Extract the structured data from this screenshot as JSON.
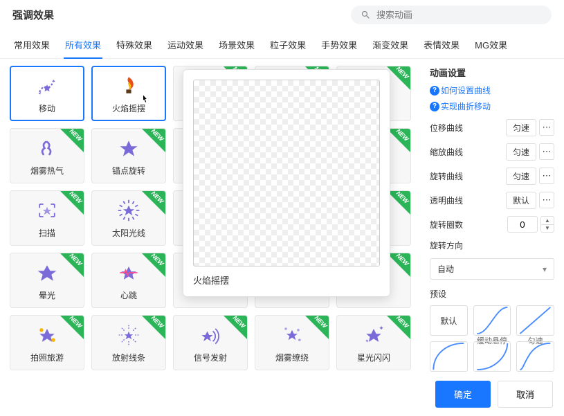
{
  "title": "强调效果",
  "search_placeholder": "搜索动画",
  "tabs": [
    "常用效果",
    "所有效果",
    "特殊效果",
    "运动效果",
    "场景效果",
    "粒子效果",
    "手势效果",
    "渐变效果",
    "表情效果",
    "MG效果"
  ],
  "active_tab": 1,
  "effects": [
    {
      "label": "移动",
      "new": false,
      "state": "selected",
      "icon": "move"
    },
    {
      "label": "火焰摇摆",
      "new": false,
      "state": "hover",
      "icon": "flame"
    },
    {
      "label": "",
      "new": true,
      "state": "",
      "icon": ""
    },
    {
      "label": "",
      "new": true,
      "state": "",
      "icon": ""
    },
    {
      "label": "",
      "new": true,
      "state": "",
      "icon": ""
    },
    {
      "label": "烟雾热气",
      "new": true,
      "state": "",
      "icon": "smoke"
    },
    {
      "label": "锚点旋转",
      "new": true,
      "state": "",
      "icon": "star"
    },
    {
      "label": "",
      "new": true,
      "state": "",
      "icon": ""
    },
    {
      "label": "",
      "new": true,
      "state": "",
      "icon": ""
    },
    {
      "label": "",
      "new": true,
      "state": "",
      "icon": ""
    },
    {
      "label": "扫描",
      "new": true,
      "state": "",
      "icon": "scan"
    },
    {
      "label": "太阳光线",
      "new": true,
      "state": "",
      "icon": "sun"
    },
    {
      "label": "",
      "new": true,
      "state": "",
      "icon": ""
    },
    {
      "label": "",
      "new": true,
      "state": "",
      "icon": ""
    },
    {
      "label": "",
      "new": true,
      "state": "",
      "icon": ""
    },
    {
      "label": "晕光",
      "new": true,
      "state": "",
      "icon": "glow"
    },
    {
      "label": "心跳",
      "new": true,
      "state": "",
      "icon": "heart"
    },
    {
      "label": "",
      "new": true,
      "state": "",
      "icon": ""
    },
    {
      "label": "",
      "new": true,
      "state": "",
      "icon": ""
    },
    {
      "label": "",
      "new": true,
      "state": "",
      "icon": ""
    },
    {
      "label": "拍照旅游",
      "new": true,
      "state": "",
      "icon": "photo"
    },
    {
      "label": "放射线条",
      "new": true,
      "state": "",
      "icon": "radial"
    },
    {
      "label": "信号发射",
      "new": true,
      "state": "",
      "icon": "signal"
    },
    {
      "label": "烟雾缭绕",
      "new": true,
      "state": "",
      "icon": "sparkle"
    },
    {
      "label": "星光闪闪",
      "new": true,
      "state": "",
      "icon": "twinkle"
    }
  ],
  "badge_text": "NEW",
  "preview_label": "火焰摇摆",
  "side": {
    "title": "动画设置",
    "help1": "如何设置曲线",
    "help2": "实现曲折移动",
    "rows": {
      "offset": {
        "label": "位移曲线",
        "value": "匀速"
      },
      "scale": {
        "label": "缩放曲线",
        "value": "匀速"
      },
      "rotate": {
        "label": "旋转曲线",
        "value": "匀速"
      },
      "opacity": {
        "label": "透明曲线",
        "value": "默认"
      },
      "turns": {
        "label": "旋转圈数",
        "value": "0"
      },
      "direction": {
        "label": "旋转方向"
      }
    },
    "direction_value": "自动",
    "preset_title": "预设",
    "presets": [
      "默认",
      "缓动悬停",
      "匀速"
    ]
  },
  "buttons": {
    "ok": "确定",
    "cancel": "取消"
  }
}
